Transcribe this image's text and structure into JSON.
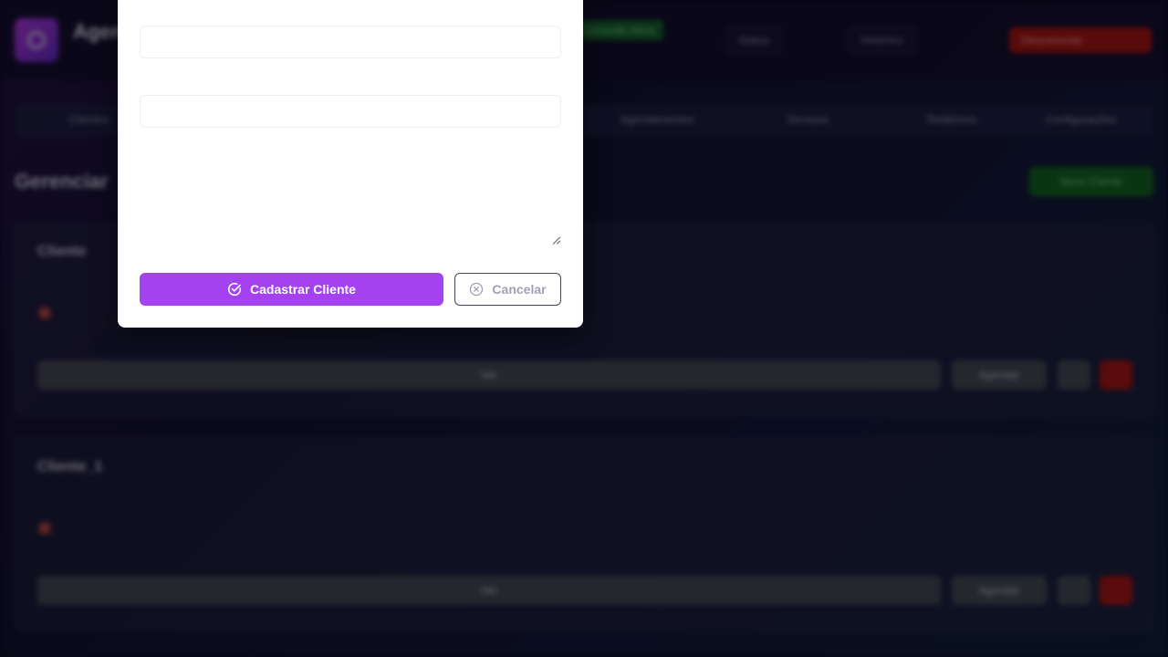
{
  "header": {
    "app_title": "Agen",
    "status_badge": "Conexão Ativa",
    "buttons": [
      "Status",
      "Histórico",
      "Desconectar"
    ]
  },
  "tabs": [
    "Clientes",
    "Agendamentos",
    "Serviços",
    "Relatórios",
    "Configurações"
  ],
  "section": {
    "title": "Gerenciar",
    "new_button": "Novo Cliente"
  },
  "clients": [
    {
      "name": "Cliente",
      "email": "",
      "phone": "",
      "date": "",
      "view_label": "Ver",
      "schedule_label": "Agendar"
    },
    {
      "name": "Cliente_1",
      "email": "",
      "phone": "",
      "date": "",
      "view_label": "Ver",
      "schedule_label": "Agendar"
    }
  ],
  "modal": {
    "field_1_value": "",
    "field_2_value": "",
    "notes_value": "",
    "submit_label": "Cadastrar Cliente",
    "cancel_label": "Cancelar",
    "accent_color": "#a442f0"
  }
}
